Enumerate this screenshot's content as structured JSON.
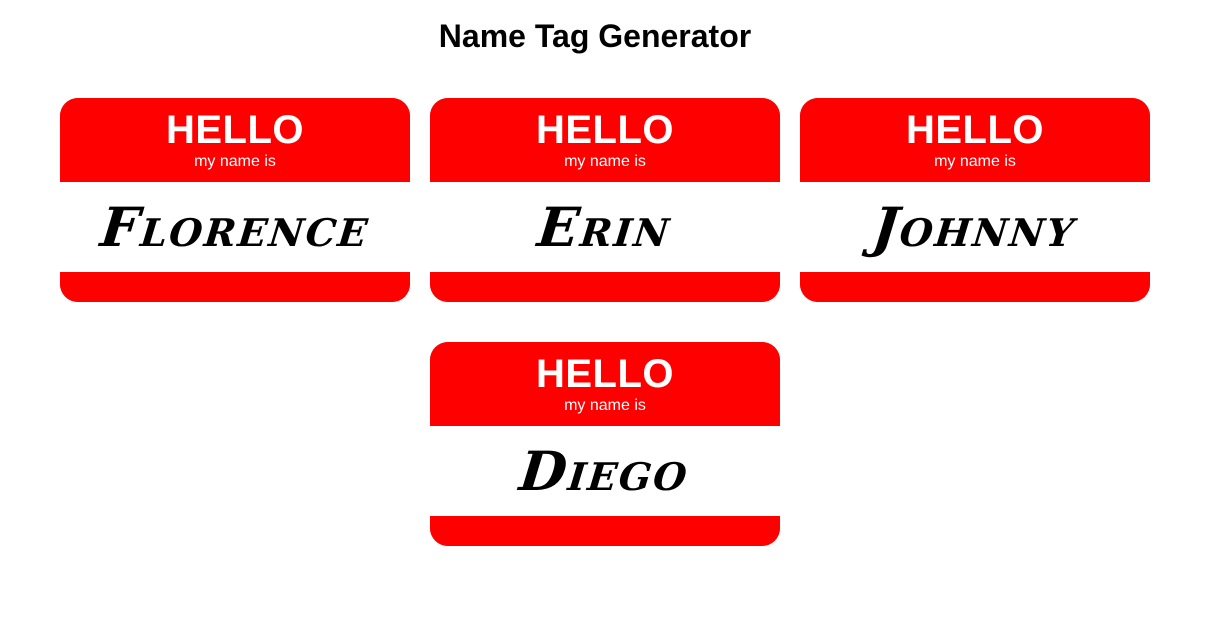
{
  "page": {
    "title": "Name Tag Generator"
  },
  "colors": {
    "tag_red": "#ff0000",
    "tag_body": "#ffffff",
    "text_dark": "#000000"
  },
  "tags": [
    {
      "hello": "HELLO",
      "subtitle": "my name is",
      "name": "Florence"
    },
    {
      "hello": "HELLO",
      "subtitle": "my name is",
      "name": "Erin"
    },
    {
      "hello": "HELLO",
      "subtitle": "my name is",
      "name": "Johnny"
    },
    {
      "hello": "HELLO",
      "subtitle": "my name is",
      "name": "Diego"
    }
  ]
}
